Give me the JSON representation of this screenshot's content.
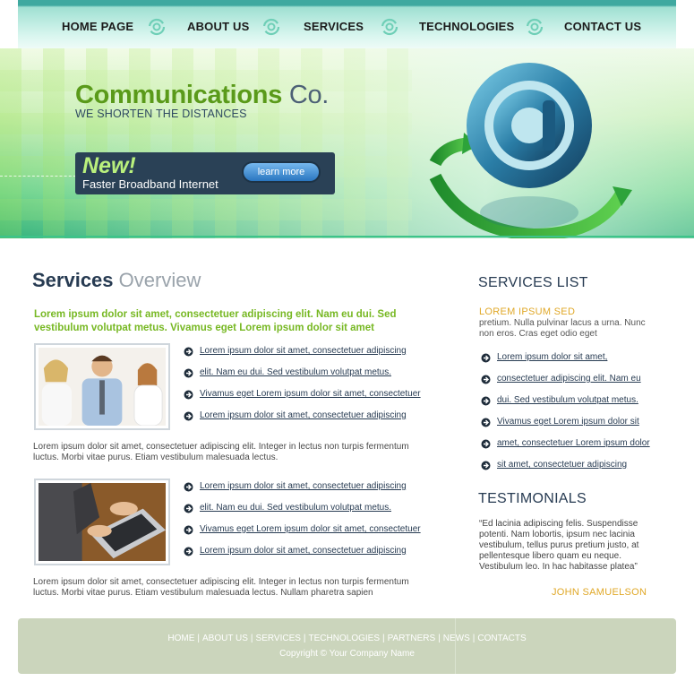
{
  "nav": {
    "items": [
      "HOME PAGE",
      "ABOUT US",
      "SERVICES",
      "TECHNOLOGIES",
      "CONTACT US"
    ]
  },
  "banner": {
    "brand": "Communications",
    "brand_suffix": "Co.",
    "tagline": "WE SHORTEN THE DISTANCES",
    "promo_badge": "New!",
    "promo_text": "Faster Broadband Internet",
    "promo_button": "learn more"
  },
  "main": {
    "title_strong": "Services",
    "title_light": "Overview",
    "lead": "Lorem ipsum dolor sit amet, consectetuer adipiscing elit. Nam eu dui. Sed vestibulum volutpat metus. Vivamus eget Lorem ipsum dolor sit amet",
    "blocks": [
      {
        "links": [
          "Lorem ipsum dolor sit amet, consectetuer adipiscing",
          "elit. Nam eu dui. Sed vestibulum volutpat metus.",
          "Vivamus eget Lorem ipsum dolor sit amet, consectetuer",
          "Lorem ipsum dolor sit amet, consectetuer adipiscing"
        ],
        "paragraph": "Lorem ipsum dolor sit amet, consectetuer adipiscing elit. Integer in lectus non turpis fermentum luctus. Morbi vitae purus. Etiam vestibulum malesuada lectus."
      },
      {
        "links": [
          "Lorem ipsum dolor sit amet, consectetuer adipiscing",
          "elit. Nam eu dui. Sed vestibulum volutpat metus.",
          "Vivamus eget Lorem ipsum dolor sit amet, consectetuer",
          "Lorem ipsum dolor sit amet, consectetuer adipiscing"
        ],
        "paragraph": "Lorem ipsum dolor sit amet, consectetuer adipiscing elit. Integer in lectus non turpis fermentum luctus. Morbi vitae purus. Etiam vestibulum malesuada lectus. Nullam pharetra sapien"
      }
    ]
  },
  "sidebar": {
    "services_title": "SERVICES LIST",
    "services_subtitle": "LOREM IPSUM SED",
    "services_text": "pretium. Nulla pulvinar lacus a urna. Nunc non eros. Cras eget odio eget",
    "services_links": [
      "Lorem ipsum dolor sit amet,",
      "consectetuer adipiscing elit. Nam eu",
      "dui. Sed vestibulum volutpat metus.",
      "Vivamus eget Lorem ipsum dolor sit",
      "amet, consectetuer Lorem ipsum dolor",
      "sit amet, consectetuer adipiscing"
    ],
    "testimonials_title": "TESTIMONIALS",
    "testimonial_text": "“Ed lacinia adipiscing felis. Suspendisse potenti. Nam lobortis, ipsum nec lacinia vestibulum, tellus purus pretium justo, at pellentesque libero quam eu neque. Vestibulum leo. In hac habitasse platea”",
    "testimonial_author": "JOHN SAMUELSON"
  },
  "footer": {
    "links": [
      "HOME",
      "ABOUT US",
      "SERVICES",
      "TECHNOLOGIES",
      "PARTNERS",
      "NEWS",
      "CONTACTS"
    ],
    "separator": "|",
    "copyright": "Copyright © Your Company Name"
  },
  "colors": {
    "accent_green": "#77b823",
    "accent_gold": "#e0a828",
    "navy": "#273b52",
    "footer_bg": "#cbd5bc"
  },
  "icons": {
    "nav_divider": "swirl-icon",
    "bullet": "arrow-bullet-icon",
    "banner_art": "at-sign-icon"
  }
}
